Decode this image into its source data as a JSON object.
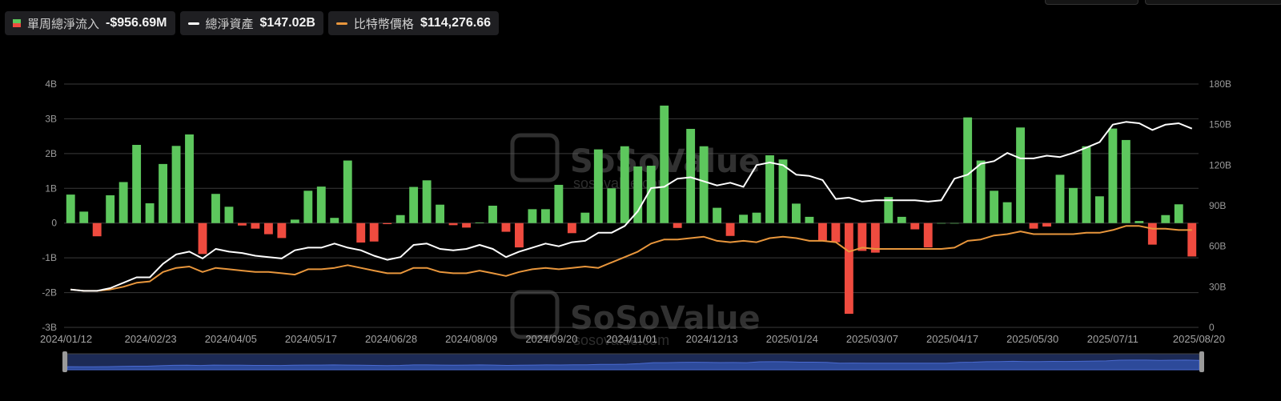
{
  "legend": {
    "flow": {
      "label": "單周總淨流入",
      "value": "-$956.69M",
      "color_pos": "#5dc75d",
      "color_neg": "#ef4b3f"
    },
    "assets": {
      "label": "總淨資產",
      "value": "$147.02B",
      "color": "#ffffff"
    },
    "btc": {
      "label": "比特幣價格",
      "value": "$114,276.66",
      "color": "#e8963c"
    }
  },
  "watermark": {
    "brand": "SoSoValue",
    "url": "sosovalue.com"
  },
  "chart_data": {
    "type": "bar",
    "x_tick_labels": [
      "2024/01/12",
      "2024/02/23",
      "2024/04/05",
      "2024/05/17",
      "2024/06/28",
      "2024/08/09",
      "2024/09/20",
      "2024/11/01",
      "2024/12/13",
      "2025/01/24",
      "2025/03/07",
      "2025/04/17",
      "2025/05/30",
      "2025/07/11",
      "2025/08/20"
    ],
    "y_left": {
      "ticks": [
        "4B",
        "3B",
        "2B",
        "1B",
        "0",
        "-1B",
        "-2B",
        "-3B"
      ],
      "range": [
        -3,
        4
      ],
      "unit": "B"
    },
    "y_right": {
      "ticks": [
        "180B",
        "150B",
        "120B",
        "90B",
        "60B",
        "30B",
        "0"
      ],
      "range": [
        0,
        180
      ],
      "unit": "B"
    },
    "grid": true,
    "series": [
      {
        "name": "單周總淨流入",
        "type": "bar",
        "axis": "left",
        "values": [
          0.82,
          0.33,
          -0.38,
          0.8,
          1.18,
          2.25,
          0.57,
          1.7,
          2.22,
          2.55,
          -0.89,
          0.84,
          0.47,
          -0.07,
          -0.16,
          -0.32,
          -0.43,
          0.1,
          0.93,
          1.05,
          0.15,
          1.8,
          -0.56,
          -0.53,
          -0.03,
          0.23,
          1.04,
          1.23,
          0.53,
          -0.06,
          -0.13,
          0.02,
          0.5,
          -0.25,
          -0.7,
          0.4,
          0.4,
          1.1,
          -0.29,
          0.3,
          2.12,
          1.0,
          2.21,
          1.63,
          1.65,
          3.38,
          -0.14,
          2.71,
          2.21,
          0.44,
          -0.37,
          0.24,
          0.3,
          1.95,
          1.83,
          0.56,
          0.18,
          -0.5,
          -0.55,
          -2.61,
          -0.8,
          -0.85,
          0.75,
          0.18,
          -0.18,
          -0.7,
          0.0,
          0.0,
          3.04,
          1.8,
          0.93,
          0.6,
          2.75,
          -0.16,
          -0.1,
          1.39,
          1.01,
          2.21,
          0.77,
          2.72,
          2.39,
          0.06,
          -0.62,
          0.23,
          0.54,
          -0.96
        ]
      },
      {
        "name": "總淨資產",
        "type": "line",
        "axis": "right",
        "values": [
          28,
          27,
          27,
          29,
          33,
          37,
          37,
          47,
          54,
          56,
          51,
          58,
          56,
          55,
          53,
          52,
          51,
          57,
          59,
          59,
          62,
          59,
          57,
          53,
          50,
          52,
          61,
          62,
          58,
          57,
          58,
          61,
          58,
          52,
          56,
          59,
          62,
          60,
          63,
          64,
          70,
          70,
          75,
          86,
          103,
          104,
          110,
          111,
          108,
          105,
          107,
          104,
          120,
          122,
          120,
          113,
          112,
          109,
          95,
          96,
          93,
          94,
          94,
          94,
          94,
          93,
          94,
          110,
          113,
          121,
          123,
          129,
          125,
          125,
          127,
          126,
          129,
          133,
          137,
          150,
          152,
          151,
          146,
          150,
          151,
          147
        ]
      },
      {
        "name": "比特幣價格",
        "type": "line",
        "axis": "right",
        "values": [
          28,
          27,
          27,
          28,
          30,
          33,
          34,
          41,
          44,
          45,
          41,
          44,
          43,
          42,
          41,
          41,
          40,
          39,
          43,
          43,
          44,
          46,
          44,
          42,
          40,
          40,
          44,
          44,
          41,
          40,
          40,
          42,
          40,
          38,
          41,
          43,
          44,
          43,
          44,
          45,
          44,
          48,
          52,
          56,
          62,
          65,
          65,
          66,
          67,
          64,
          63,
          64,
          63,
          66,
          67,
          66,
          64,
          64,
          63,
          56,
          59,
          58,
          58,
          58,
          58,
          58,
          58,
          59,
          64,
          65,
          68,
          69,
          71,
          69,
          69,
          69,
          69,
          70,
          70,
          72,
          75,
          75,
          73,
          73,
          72,
          72
        ]
      }
    ]
  }
}
